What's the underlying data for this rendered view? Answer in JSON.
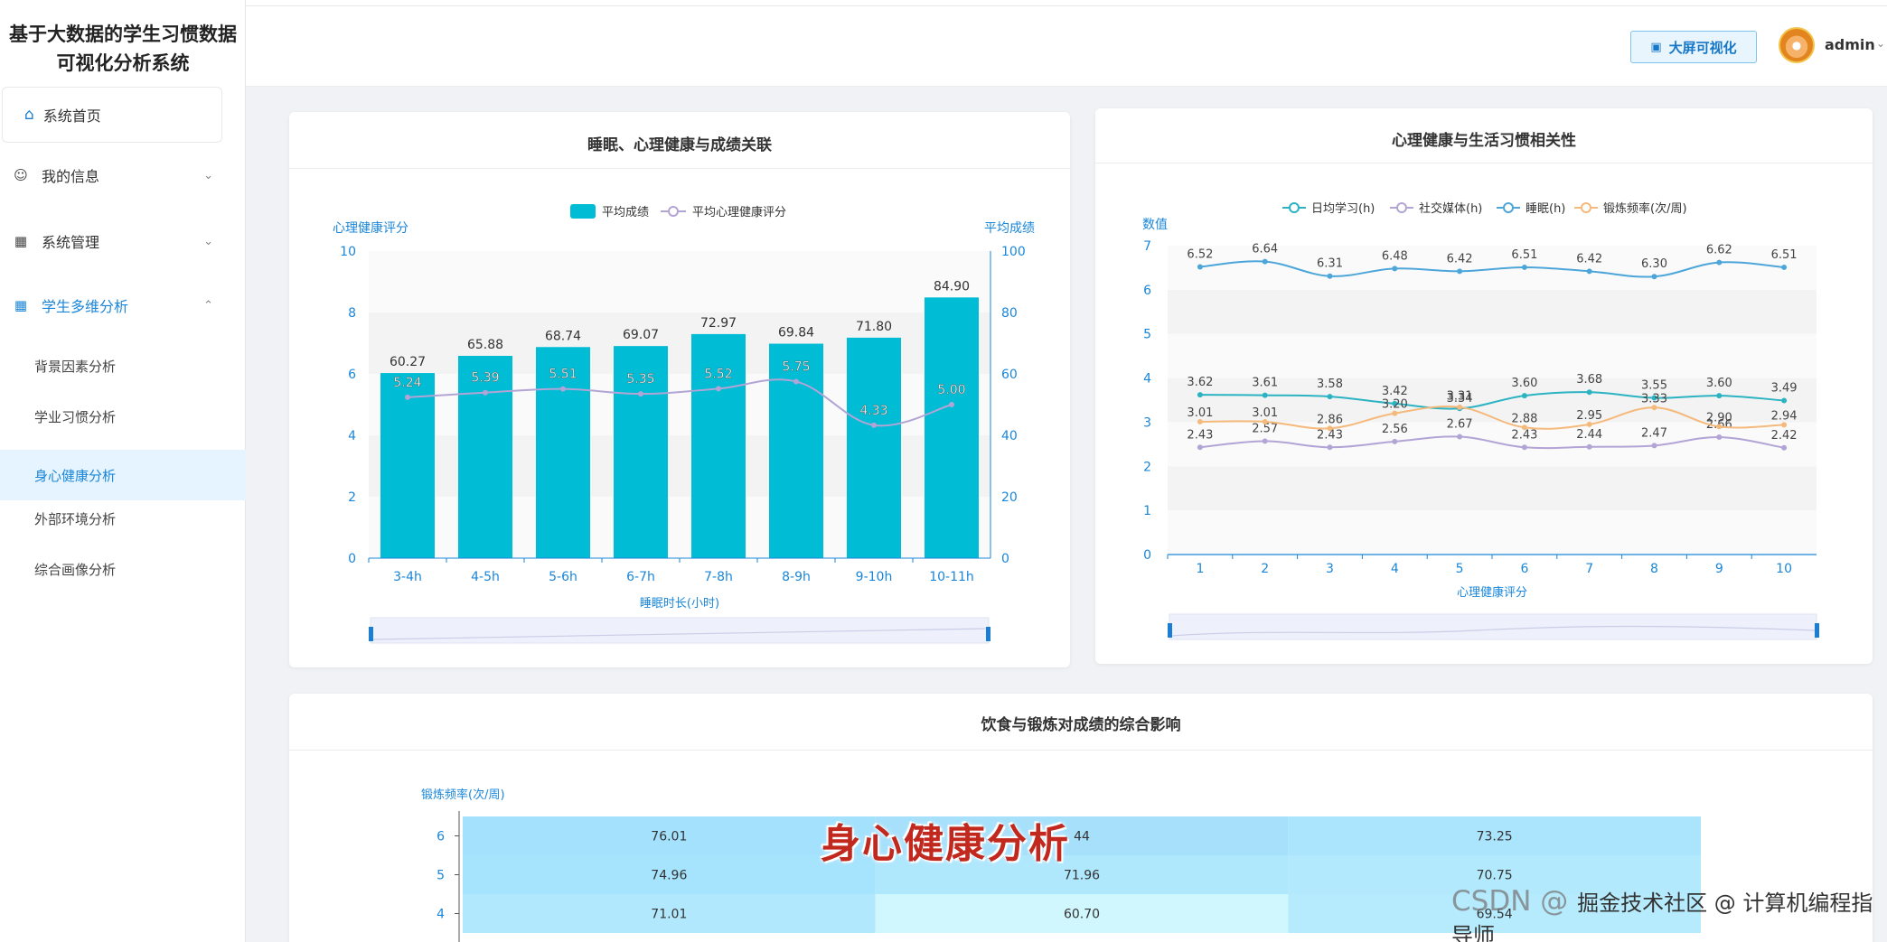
{
  "app": {
    "title": "基于大数据的学生习惯数据可视化分析系统",
    "title_line1": "基于大数据的学生习惯数据",
    "title_line2": "可视化分析系统"
  },
  "sidebar": {
    "home": "系统首页",
    "my_info": "我的信息",
    "sys_manage": "系统管理",
    "multi_analysis": "学生多维分析",
    "sub_items": [
      "背景因素分析",
      "学业习惯分析",
      "身心健康分析",
      "外部环境分析",
      "综合画像分析"
    ],
    "selected_sub": "身心健康分析"
  },
  "header": {
    "big_screen_label": "大屏可视化",
    "username": "admin"
  },
  "colors": {
    "accent": "#1a86d9",
    "bar": "#00bcd4",
    "line_purple": "#b3a4d6",
    "line_teal": "#2cb3c2",
    "line_blue": "#4da6d9",
    "line_orange": "#f5b97b"
  },
  "chart1": {
    "title": "睡眠、心理健康与成绩关联",
    "chart_data": {
      "type": "bar",
      "categories": [
        "3-4h",
        "4-5h",
        "5-6h",
        "6-7h",
        "7-8h",
        "8-9h",
        "9-10h",
        "10-11h"
      ],
      "series": [
        {
          "name": "平均成绩",
          "type": "bar",
          "axis": "right",
          "values": [
            60.27,
            65.88,
            68.74,
            69.07,
            72.97,
            69.84,
            71.8,
            84.9
          ]
        },
        {
          "name": "平均心理健康评分",
          "type": "line",
          "axis": "left",
          "values": [
            5.24,
            5.39,
            5.51,
            5.35,
            5.52,
            5.75,
            4.33,
            5.0
          ]
        }
      ],
      "xlabel": "睡眠时长(小时)",
      "ylabel_left": "心理健康评分",
      "ylabel_right": "平均成绩",
      "ylim_left": [
        0,
        10
      ],
      "ylim_right": [
        0,
        100
      ],
      "yticks_left": [
        0,
        2,
        4,
        6,
        8,
        10
      ],
      "yticks_right": [
        0,
        20,
        40,
        60,
        80,
        100
      ],
      "legend": "top-center"
    }
  },
  "chart2": {
    "title": "心理健康与生活习惯相关性",
    "chart_data": {
      "type": "line",
      "x": [
        1,
        2,
        3,
        4,
        5,
        6,
        7,
        8,
        9,
        10
      ],
      "series": [
        {
          "name": "日均学习(h)",
          "values": [
            3.62,
            3.61,
            3.58,
            3.42,
            3.31,
            3.6,
            3.68,
            3.55,
            3.6,
            3.49
          ]
        },
        {
          "name": "社交媒体(h)",
          "values": [
            2.43,
            2.57,
            2.43,
            2.56,
            2.67,
            2.43,
            2.44,
            2.47,
            2.66,
            2.42
          ]
        },
        {
          "name": "睡眠(h)",
          "values": [
            6.52,
            6.64,
            6.31,
            6.48,
            6.42,
            6.51,
            6.42,
            6.3,
            6.62,
            6.51
          ]
        },
        {
          "name": "锻炼频率(次/周)",
          "values": [
            3.01,
            3.01,
            2.86,
            3.2,
            3.34,
            2.88,
            2.95,
            3.33,
            2.9,
            2.94
          ]
        }
      ],
      "xlabel": "心理健康评分",
      "ylabel": "数值",
      "ylim": [
        0,
        7
      ],
      "yticks": [
        0,
        1,
        2,
        3,
        4,
        5,
        6,
        7
      ],
      "legend": "top-center"
    }
  },
  "chart3": {
    "title": "饮食与锻炼对成绩的综合影响",
    "chart_data": {
      "type": "heatmap",
      "ylabel": "锻炼频率(次/周)",
      "rows": [
        {
          "y": "6",
          "values": [
            76.01,
            null,
            73.25
          ],
          "partial": [
            "",
            "44",
            ""
          ]
        },
        {
          "y": "5",
          "values": [
            74.96,
            71.96,
            70.75
          ]
        },
        {
          "y": "4",
          "values": [
            71.01,
            60.7,
            69.54
          ]
        }
      ]
    }
  },
  "overlay": {
    "watermark": "身心健康分析",
    "csdn_prefix": "CSDN @",
    "csdn_text": "掘金技术社区 @ 计算机编程指导师"
  }
}
